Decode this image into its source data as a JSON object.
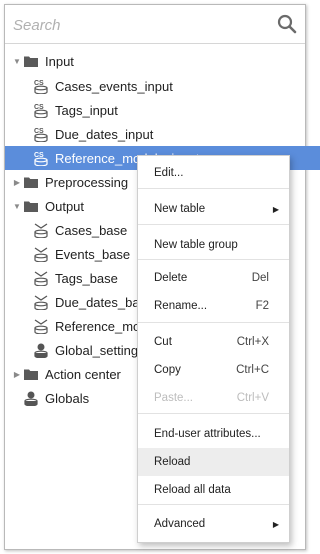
{
  "search": {
    "placeholder": "Search"
  },
  "tree": [
    {
      "label": "Input",
      "level": 0,
      "caret": "down",
      "icon": "folder-icon"
    },
    {
      "label": "Cases_events_input",
      "level": 1,
      "icon": "cs-table-icon"
    },
    {
      "label": "Tags_input",
      "level": 1,
      "icon": "cs-table-icon"
    },
    {
      "label": "Due_dates_input",
      "level": 1,
      "icon": "cs-table-icon"
    },
    {
      "label": "Reference_models_input",
      "level": 1,
      "icon": "cs-table-icon",
      "selected": true
    },
    {
      "label": "Preprocessing",
      "level": 0,
      "caret": "right",
      "icon": "folder-icon"
    },
    {
      "label": "Output",
      "level": 0,
      "caret": "down",
      "icon": "folder-icon"
    },
    {
      "label": "Cases_base",
      "level": 1,
      "icon": "base-table-icon"
    },
    {
      "label": "Events_base",
      "level": 1,
      "icon": "base-table-icon"
    },
    {
      "label": "Tags_base",
      "level": 1,
      "icon": "base-table-icon"
    },
    {
      "label": "Due_dates_base",
      "level": 1,
      "icon": "base-table-icon"
    },
    {
      "label": "Reference_models_base",
      "level": 1,
      "icon": "base-table-icon"
    },
    {
      "label": "Global_settings",
      "level": 1,
      "icon": "global-settings-icon"
    },
    {
      "label": "Action center",
      "level": 0,
      "caret": "right",
      "icon": "folder-icon"
    },
    {
      "label": "Globals",
      "level": 0,
      "icon": "globals-icon"
    }
  ],
  "context_menu": {
    "items": [
      {
        "label": "Edit...",
        "shortcut": ""
      },
      {
        "label": "New table",
        "shortcut": "",
        "submenu": true
      },
      {
        "label": "New table group",
        "shortcut": ""
      },
      {
        "label": "Delete",
        "shortcut": "Del"
      },
      {
        "label": "Rename...",
        "shortcut": "F2"
      },
      {
        "label": "Cut",
        "shortcut": "Ctrl+X"
      },
      {
        "label": "Copy",
        "shortcut": "Ctrl+C"
      },
      {
        "label": "Paste...",
        "shortcut": "Ctrl+V",
        "disabled": true
      },
      {
        "label": "End-user attributes...",
        "shortcut": ""
      },
      {
        "label": "Reload",
        "shortcut": "",
        "hovered": true
      },
      {
        "label": "Reload all data",
        "shortcut": ""
      },
      {
        "label": "Advanced",
        "shortcut": "",
        "submenu": true
      }
    ]
  },
  "colors": {
    "selection": "#5b8ddb",
    "folder": "#5a5a5a",
    "menu_hover": "#ededed"
  }
}
